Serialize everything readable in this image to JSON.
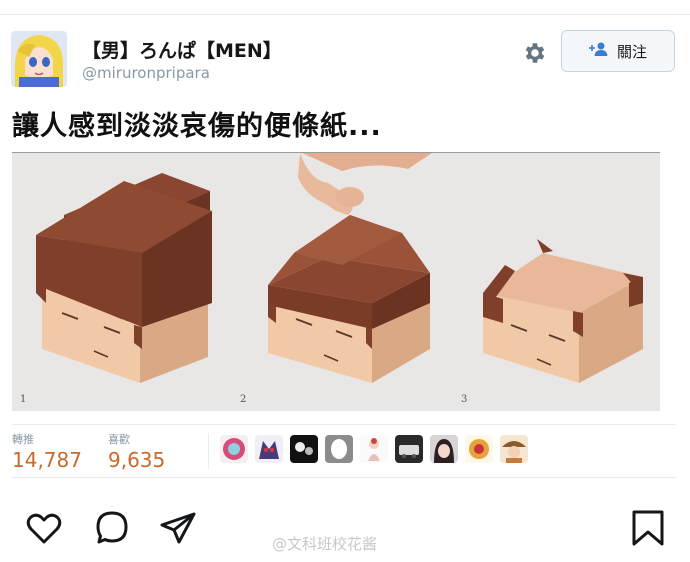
{
  "user": {
    "display_name": "【男】ろんぱ【MEN】",
    "handle": "@miruronpripara",
    "follow_label": "關注"
  },
  "tweet": {
    "text": "讓人感到淡淡哀傷的便條紙..."
  },
  "media": {
    "panels": [
      "1",
      "2",
      "3"
    ]
  },
  "stats": {
    "retweets_label": "轉推",
    "retweets_value": "14,787",
    "likes_label": "喜歡",
    "likes_value": "9,635"
  },
  "icons": [
    "settings-gear",
    "follow-person-plus",
    "heart",
    "reply-bubble",
    "share-arrow",
    "bookmark"
  ],
  "colors": {
    "stat_number": "#c96a2a",
    "accent_gray": "#8899a6",
    "box_brown": "#7b3b27",
    "skin": "#f2c9a6"
  },
  "watermark": "@文科班校花酱"
}
